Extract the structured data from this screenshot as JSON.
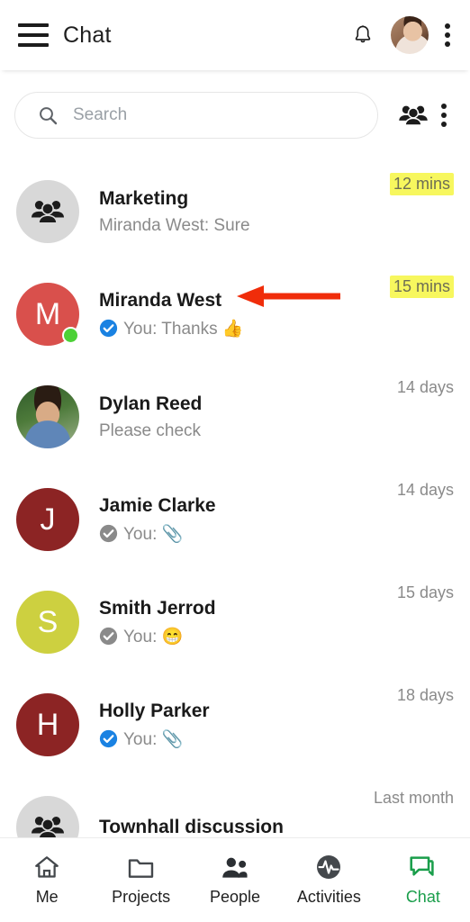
{
  "header": {
    "title": "Chat",
    "menu_icon": "hamburger-icon",
    "bell_icon": "notification-bell-icon",
    "avatar_icon": "profile-avatar",
    "overflow_icon": "kebab-menu-icon"
  },
  "search": {
    "placeholder": "Search",
    "value": "",
    "search_icon": "search-icon",
    "group_icon": "group-people-icon",
    "overflow_icon": "kebab-menu-icon"
  },
  "annotation": {
    "arrow_color": "#f02d0a",
    "points_to": "Miranda West"
  },
  "chats": [
    {
      "name": "Marketing",
      "preview": "Miranda West: Sure",
      "time": "12 mins",
      "highlight": true,
      "avatar_type": "group",
      "avatar_initial": "",
      "avatar_color": "#d8d8d8",
      "tick": "none",
      "online": false
    },
    {
      "name": "Miranda West",
      "preview": "You: Thanks 👍",
      "time": "15 mins",
      "highlight": true,
      "avatar_type": "initial",
      "avatar_initial": "M",
      "avatar_color": "#d9504c",
      "tick": "read",
      "online": true
    },
    {
      "name": "Dylan Reed",
      "preview": "Please check",
      "time": "14 days",
      "highlight": false,
      "avatar_type": "photo-dylan",
      "avatar_initial": "",
      "avatar_color": "#4d7a3a",
      "tick": "none",
      "online": false
    },
    {
      "name": "Jamie Clarke",
      "preview": "You: 📎",
      "time": "14 days",
      "highlight": false,
      "avatar_type": "initial",
      "avatar_initial": "J",
      "avatar_color": "#8c2424",
      "tick": "delivered",
      "online": false
    },
    {
      "name": "Smith Jerrod",
      "preview": "You: 😁",
      "time": "15 days",
      "highlight": false,
      "avatar_type": "initial",
      "avatar_initial": "S",
      "avatar_color": "#cdd040",
      "tick": "delivered",
      "online": false
    },
    {
      "name": "Holly Parker",
      "preview": "You: 📎",
      "time": "18 days",
      "highlight": false,
      "avatar_type": "initial",
      "avatar_initial": "H",
      "avatar_color": "#8c2424",
      "tick": "read",
      "online": false
    },
    {
      "name": "Townhall discussion",
      "preview": "",
      "time": "Last month",
      "highlight": false,
      "avatar_type": "group",
      "avatar_initial": "",
      "avatar_color": "#d8d8d8",
      "tick": "none",
      "online": false
    }
  ],
  "bottom_nav": {
    "active": "Chat",
    "items": [
      {
        "label": "Me",
        "icon": "home-icon"
      },
      {
        "label": "Projects",
        "icon": "folder-icon"
      },
      {
        "label": "People",
        "icon": "people-icon"
      },
      {
        "label": "Activities",
        "icon": "activity-pulse-icon"
      },
      {
        "label": "Chat",
        "icon": "chat-bubbles-icon"
      }
    ]
  },
  "colors": {
    "accent_green": "#1a9e4b",
    "highlight_yellow": "#f7f75e",
    "read_tick_blue": "#1a82e2",
    "delivered_tick_gray": "#8a8a8a",
    "online_green": "#4cd137"
  }
}
